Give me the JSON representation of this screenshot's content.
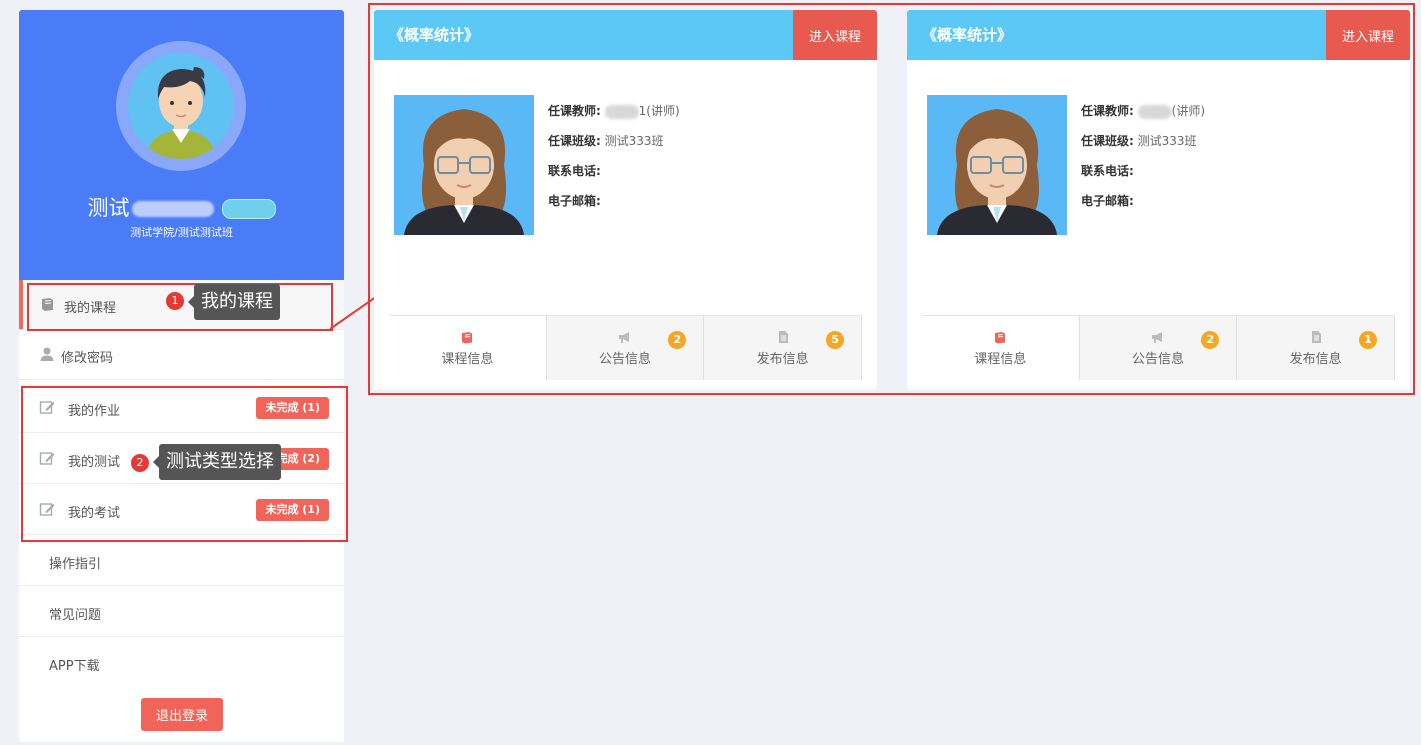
{
  "profile": {
    "name": "测试",
    "department": "测试学院/测试测试班"
  },
  "nav": {
    "my_courses": "我的课程",
    "change_password": "修改密码",
    "my_homework": "我的作业",
    "my_tests": "我的测试",
    "my_exams": "我的考试",
    "guide": "操作指引",
    "faq": "常见问题",
    "app_download": "APP下载",
    "homework_badge": "未完成 (1)",
    "tests_badge": "未完成 (2)",
    "exams_badge": "未完成 (1)",
    "logout": "退出登录"
  },
  "annotations": {
    "n1": "1",
    "tip1": "我的课程",
    "n2": "2",
    "tip2": "测试类型选择"
  },
  "courses": [
    {
      "title": "《概率统计》",
      "enter": "进入课程",
      "teacher_label": "任课教师:",
      "teacher_value": "1(讲师)",
      "class_label": "任课班级:",
      "class_value": "测试333班",
      "phone_label": "联系电话:",
      "email_label": "电子邮箱:",
      "tab_course": "课程信息",
      "tab_notice": "公告信息",
      "tab_publish": "发布信息",
      "notice_count": "2",
      "publish_count": "5"
    },
    {
      "title": "《概率统计》",
      "enter": "进入课程",
      "teacher_label": "任课教师:",
      "teacher_value": "(讲师)",
      "class_label": "任课班级:",
      "class_value": "测试333班",
      "phone_label": "联系电话:",
      "email_label": "电子邮箱:",
      "tab_course": "课程信息",
      "tab_notice": "公告信息",
      "tab_publish": "发布信息",
      "notice_count": "2",
      "publish_count": "1"
    }
  ],
  "colors": {
    "profile_bg": "#4a7cf7",
    "card_header": "#5bc8f5",
    "accent_red": "#e85a4f",
    "count_badge": "#f5a623",
    "annotation": "#e53935"
  }
}
